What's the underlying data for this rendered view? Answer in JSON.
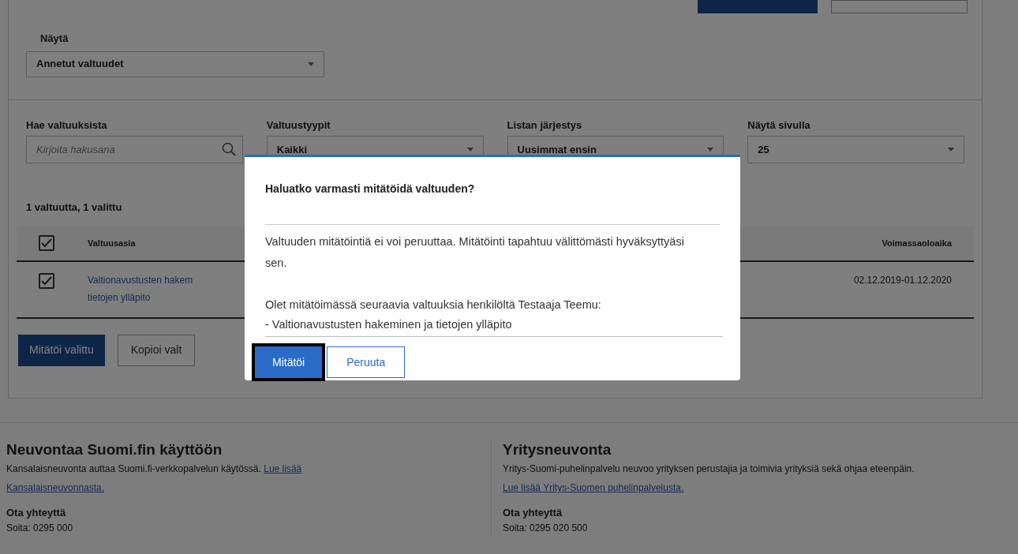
{
  "view_select": {
    "label": "Näytä",
    "value": "Annetut valtuudet"
  },
  "filters": [
    {
      "kind": "search",
      "label": "Hae valtuuksista",
      "placeholder": "Kirjoita hakusana"
    },
    {
      "kind": "select",
      "label": "Valtuustyypit",
      "value": "Kaikki"
    },
    {
      "kind": "select",
      "label": "Listan järjestys",
      "value": "Uusimmat ensin"
    },
    {
      "kind": "select",
      "label": "Näytä sivulla",
      "value": "25"
    }
  ],
  "count_text": "1 valtuutta, 1 valittu",
  "table": {
    "header_checked": true,
    "columns": [
      "Valtuusasia",
      "Voimassaoloaika"
    ],
    "rows": [
      {
        "checked": true,
        "matter_lines": [
          "Valtionavustusten hakem",
          "tietojen ylläpito"
        ],
        "validity": "02.12.2019-01.12.2020"
      }
    ]
  },
  "actions": [
    {
      "kind": "primary",
      "label": "Mitätöi valittu"
    },
    {
      "kind": "secondary",
      "label": "Kopioi valt"
    }
  ],
  "dialog": {
    "title": "Haluatko varmasti mitätöidä valtuuden?",
    "paragraphs": [
      "Valtuuden mitätöintiä ei voi peruuttaa. Mitätöinti tapahtuu välittömästi hyväksyttyäsi sen.",
      "Olet mitätöimässä seuraavia valtuuksia henkilöltä Testaaja Teemu:"
    ],
    "items": [
      "- Valtionavustusten hakeminen ja tietojen ylläpito"
    ],
    "buttons": [
      {
        "kind": "primary",
        "label": "Mitätöi",
        "focused": true
      },
      {
        "kind": "secondary",
        "label": "Peruuta",
        "focused": false
      }
    ]
  },
  "footer": [
    {
      "title": "Neuvontaa Suomi.fin käyttöön",
      "text": "Kansalaisneuvonta auttaa Suomi.fi-verkkopalvelun käytössä.",
      "link_lines": [
        "Lue lisää",
        "Kansalaisneuvonnasta."
      ],
      "contact_title": "Ota yhteyttä",
      "contact": "Soita: 0295 000"
    },
    {
      "title": "Yritysneuvonta",
      "text": "Yritys-Suomi-puhelinpalvelu neuvoo yrityksen perustajia ja toimivia yrityksiä sekä ohjaa eteenpäin.",
      "link_lines": [
        "Lue lisää Yritys-Suomen puhelinpalvelusta."
      ],
      "contact_title": "Ota yhteyttä",
      "contact": "Soita: 0295 020 500"
    }
  ]
}
